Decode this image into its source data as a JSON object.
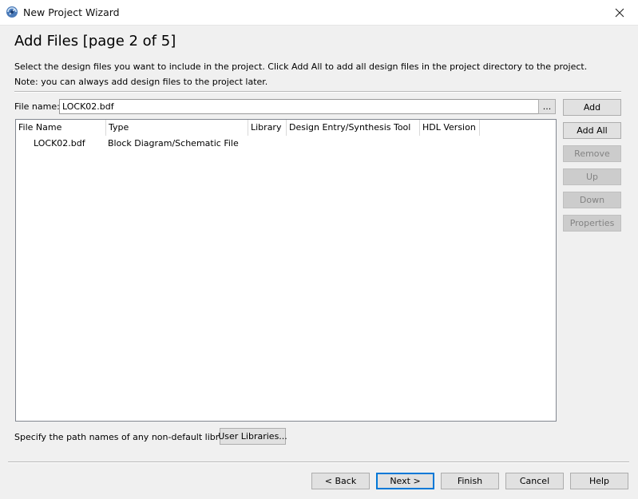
{
  "window": {
    "title": "New Project Wizard",
    "close_label": "✕"
  },
  "page": {
    "title": "Add Files [page 2 of 5]",
    "description_1": "Select the design files you want to include in the project. Click Add All to add all design files in the project directory to the project.",
    "description_2": "Note: you can always add design files to the project later."
  },
  "file_name": {
    "label": "File name:",
    "value": "LOCK02.bdf",
    "browse_label": "..."
  },
  "side_buttons": {
    "add": "Add",
    "add_all": "Add All",
    "remove": "Remove",
    "up": "Up",
    "down": "Down",
    "properties": "Properties"
  },
  "table": {
    "columns": [
      "File Name",
      "Type",
      "Library",
      "Design Entry/Synthesis Tool",
      "HDL Version"
    ],
    "rows": [
      [
        "LOCK02.bdf",
        "Block Diagram/Schematic File",
        "",
        "",
        ""
      ]
    ]
  },
  "libraries": {
    "label": "Specify the path names of any non-default libraries.",
    "button": "User Libraries..."
  },
  "footer": {
    "back": "< Back",
    "next": "Next >",
    "finish": "Finish",
    "cancel": "Cancel",
    "help": "Help"
  },
  "colors": {
    "focus_border": "#0078d7",
    "window_bg": "#f0f0f0"
  }
}
